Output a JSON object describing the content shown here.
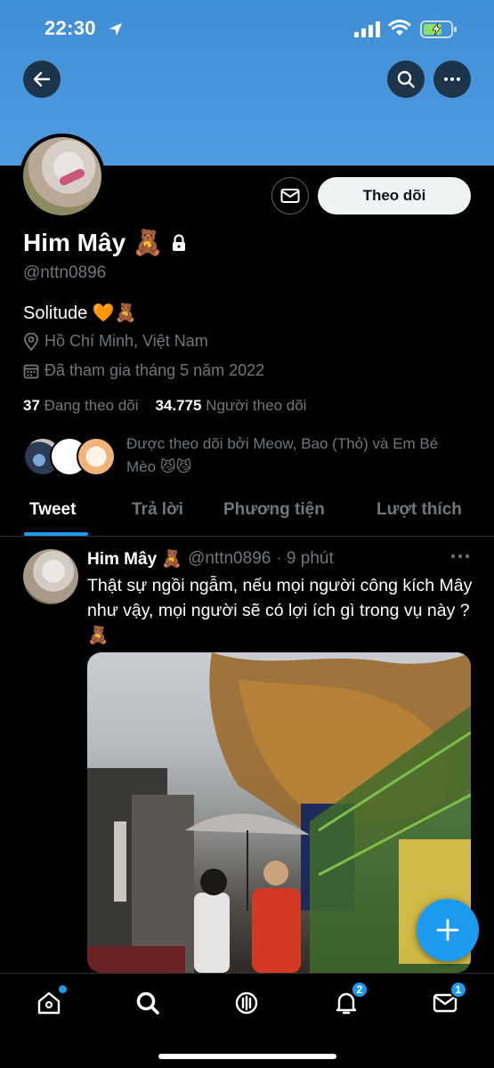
{
  "status_bar": {
    "time": "22:30"
  },
  "profile": {
    "display_name": "Him Mây 🧸",
    "handle": "@nttn0896",
    "bio": "Solitude 🧡🧸",
    "location": "Hồ Chí Minh, Việt Nam",
    "joined": "Đã tham gia tháng 5 năm 2022",
    "following_count": "37",
    "following_label": "Đang theo dõi",
    "followers_count": "34.775",
    "followers_label": "Người theo dõi",
    "followed_by": "Được theo dõi bởi Meow, Bao (Thỏ) và Em Bé Mèo 😼😼",
    "follow_button": "Theo dõi"
  },
  "tabs": [
    {
      "label": "Tweet",
      "active": true
    },
    {
      "label": "Trả lời",
      "active": false
    },
    {
      "label": "Phương tiện",
      "active": false
    },
    {
      "label": "Lượt thích",
      "active": false
    }
  ],
  "tweet": {
    "name": "Him Mây 🧸",
    "handle": "@nttn0896",
    "time": "· 9 phút",
    "text": "Thật sự ngồi ngẫm, nếu mọi người công kích Mây như vậy, mọi người sẽ có lợi ích gì trong vụ này ? 🧸"
  },
  "bottom_nav": {
    "notifications_badge": "2",
    "messages_badge": "1"
  },
  "colors": {
    "accent": "#1d9bf0",
    "banner": "#4e9be0",
    "background": "#000000"
  }
}
